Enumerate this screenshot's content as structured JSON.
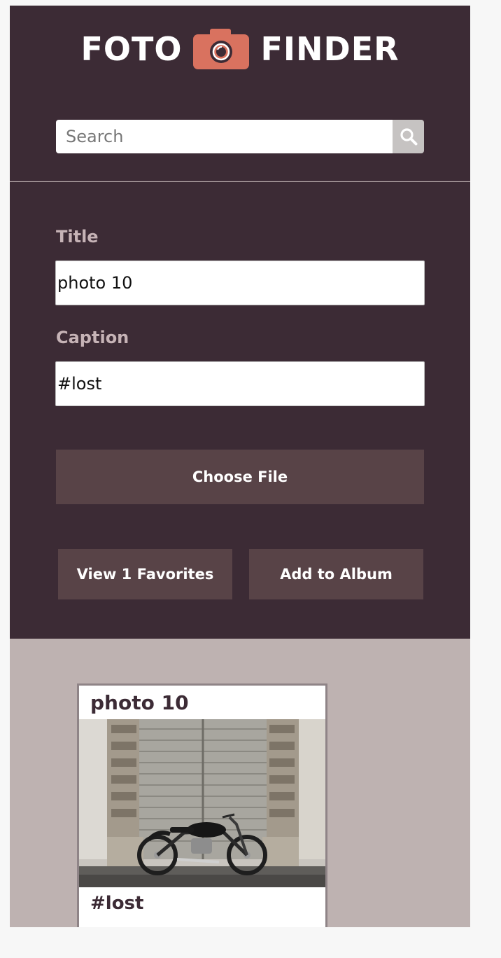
{
  "header": {
    "logo_left": "FOTO",
    "logo_right": "FINDER",
    "logo_icon": "camera-icon",
    "accent_color": "#d9725f"
  },
  "search": {
    "placeholder": "Search",
    "value": "",
    "icon": "search-icon"
  },
  "form": {
    "title_label": "Title",
    "title_value": "photo 10",
    "caption_label": "Caption",
    "caption_value": "#lost",
    "choose_file_label": "Choose File",
    "view_favorites_label": "View 1 Favorites",
    "add_to_album_label": "Add to Album"
  },
  "album": {
    "cards": [
      {
        "title": "photo 10",
        "caption": "#lost",
        "image": "motorcycle in front of wooden door"
      }
    ]
  },
  "colors": {
    "header_bg": "#3c2b35",
    "button_bg": "#584347",
    "album_bg": "#beb2b1",
    "label_color": "#c6b3b6"
  }
}
